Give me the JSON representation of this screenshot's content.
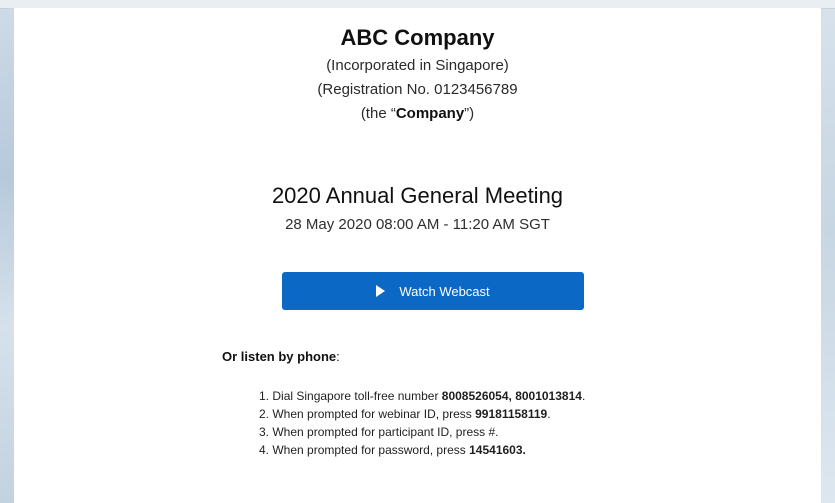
{
  "company": {
    "name": "ABC Company",
    "incorporation": "(Incorporated in Singapore)",
    "registration": "(Registration No. 0123456789",
    "short_name_prefix": "(the “",
    "short_name": "Company",
    "short_name_suffix": "”)"
  },
  "meeting": {
    "title": "2020 Annual General Meeting",
    "datetime": "28 May 2020 08:00 AM - 11:20 AM SGT",
    "watch_button_label": "Watch Webcast"
  },
  "phone": {
    "heading": "Or listen by phone",
    "heading_suffix": ":",
    "steps": [
      {
        "number": "1.",
        "text": "Dial Singapore toll-free number ",
        "highlight": "8008526054, 8001013814",
        "suffix": "."
      },
      {
        "number": "2.",
        "text": "When prompted for webinar ID, press ",
        "highlight": "99181158119",
        "suffix": "."
      },
      {
        "number": "3.",
        "text": "When prompted for participant ID, press #.",
        "highlight": "",
        "suffix": ""
      },
      {
        "number": "4.",
        "text": "When prompted for password, press ",
        "highlight": "14541603.",
        "suffix": ""
      }
    ]
  }
}
